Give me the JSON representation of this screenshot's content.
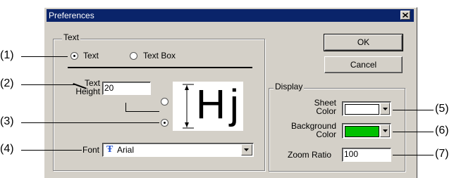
{
  "dialog": {
    "title": "Preferences",
    "close_glyph": "✕"
  },
  "text_group": {
    "label": "Text",
    "radio_text": "Text",
    "radio_textbox": "Text Box",
    "selected": "Text",
    "height_label_1": "Text",
    "height_label_2": "Height",
    "height_value": "20",
    "font_label": "Font",
    "font_value": "Arial",
    "font_icon_glyph": "Ŧ",
    "preview_text": "Hj"
  },
  "buttons": {
    "ok": "OK",
    "cancel": "Cancel"
  },
  "display_group": {
    "label": "Display",
    "sheet_color_label_1": "Sheet",
    "sheet_color_label_2": "Color",
    "sheet_color": "#ffffff",
    "bg_color_label_1": "Background",
    "bg_color_label_2": "Color",
    "bg_color": "#00c000",
    "zoom_label": "Zoom Ratio",
    "zoom_value": "100"
  },
  "callouts": {
    "c1": "(1)",
    "c2": "(2)",
    "c3": "(3)",
    "c4": "(4)",
    "c5": "(5)",
    "c6": "(6)",
    "c7": "(7)"
  },
  "icons": [
    "close-icon",
    "font-type-icon",
    "dropdown-arrow-icon",
    "radio-icon"
  ]
}
